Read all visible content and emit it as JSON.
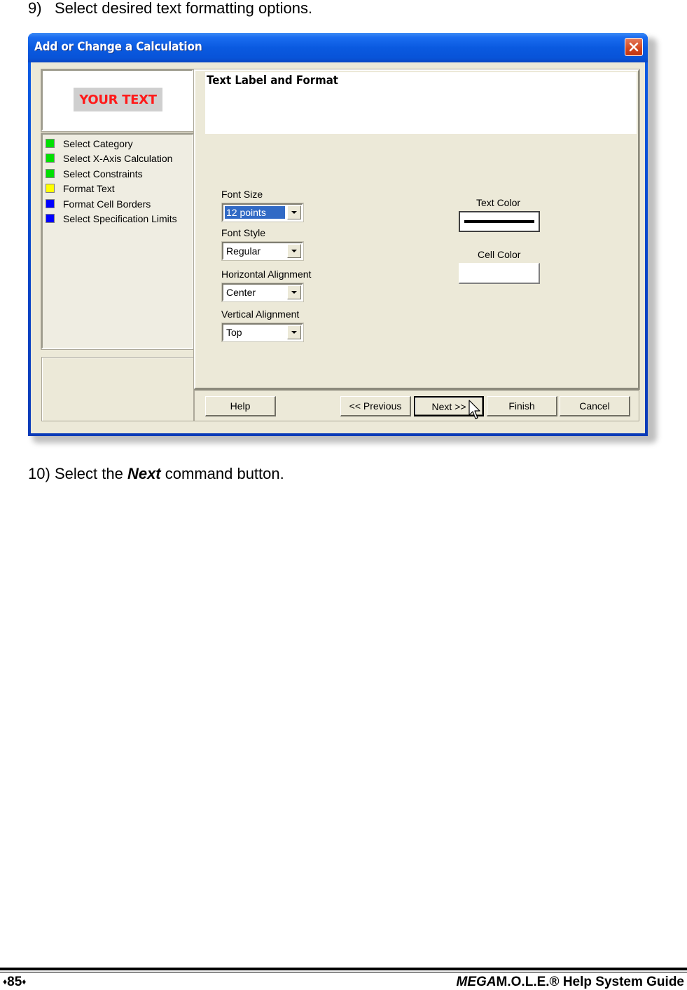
{
  "document": {
    "step9": {
      "number": "9)",
      "text": "Select desired text formatting options."
    },
    "step10": {
      "number": "10)",
      "text_before": "Select the ",
      "emphasis": "Next",
      "text_after": " command button."
    },
    "footer": {
      "page_number": "85",
      "page_marker_icon": "diamond",
      "guide_brand_italic": "MEGA",
      "guide_title": "M.O.L.E.® Help System Guide"
    }
  },
  "dialog": {
    "title": "Add or Change a Calculation",
    "close_icon": "close-x-icon",
    "preview": {
      "sample_text": "YOUR TEXT",
      "text_color": "#ff1a1a",
      "chip_color": "#cfcfcf"
    },
    "wizard_steps": [
      {
        "label": "Select Category",
        "status_color": "#00e000",
        "status": "complete"
      },
      {
        "label": "Select X-Axis Calculation",
        "status_color": "#00e000",
        "status": "complete"
      },
      {
        "label": "Select Constraints",
        "status_color": "#00e000",
        "status": "complete"
      },
      {
        "label": "Format Text",
        "status_color": "#ffff00",
        "status": "current"
      },
      {
        "label": "Format Cell Borders",
        "status_color": "#0000ff",
        "status": "pending"
      },
      {
        "label": "Select Specification Limits",
        "status_color": "#0000ff",
        "status": "pending"
      }
    ],
    "panel": {
      "heading": "Text Label and Format",
      "font_size": {
        "label": "Font Size",
        "value": "12 points"
      },
      "font_style": {
        "label": "Font Style",
        "value": "Regular"
      },
      "horizontal_alignment": {
        "label": "Horizontal Alignment",
        "value": "Center"
      },
      "vertical_alignment": {
        "label": "Vertical Alignment",
        "value": "Top"
      },
      "text_color": {
        "label": "Text Color",
        "value": "#000000"
      },
      "cell_color": {
        "label": "Cell Color",
        "value": "#ffffff"
      }
    },
    "buttons": {
      "help": "Help",
      "previous": "<< Previous",
      "next": "Next >>",
      "finish": "Finish",
      "cancel": "Cancel"
    },
    "colors": {
      "title_bar": "#0a5ae0",
      "client_bg": "#ece9d8",
      "selection": "#316ac5"
    }
  }
}
